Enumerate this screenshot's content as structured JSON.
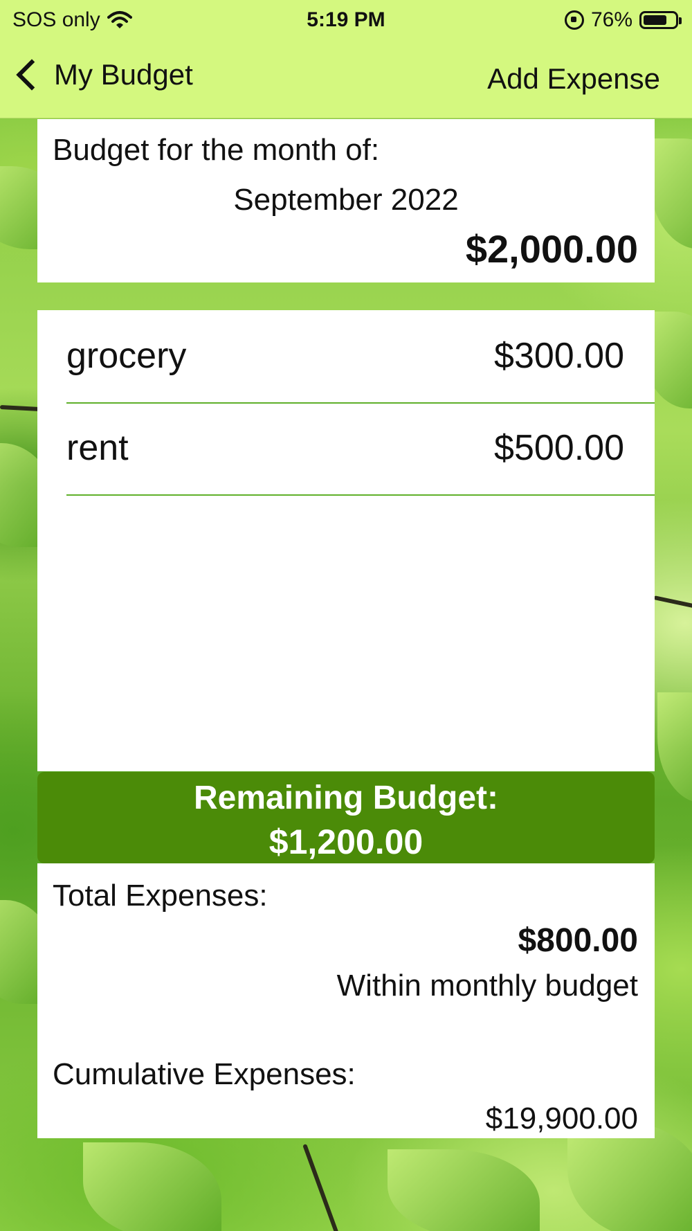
{
  "status_bar": {
    "carrier": "SOS only",
    "time": "5:19 PM",
    "battery_percent": "76%",
    "battery_level": 0.76,
    "icons": [
      "wifi-icon",
      "orientation-lock-icon",
      "battery-icon"
    ]
  },
  "nav": {
    "back_label": "My Budget",
    "action_label": "Add Expense"
  },
  "budget": {
    "label": "Budget for the month of:",
    "month": "September 2022",
    "amount": "$2,000.00"
  },
  "expenses": [
    {
      "name": "grocery",
      "amount": "$300.00"
    },
    {
      "name": "rent",
      "amount": "$500.00"
    }
  ],
  "remaining": {
    "label": "Remaining Budget:",
    "amount": "$1,200.00"
  },
  "summary": {
    "total_label": "Total Expenses:",
    "total_amount": "$800.00",
    "status": "Within monthly budget",
    "cumulative_label": "Cumulative Expenses:",
    "cumulative_amount": "$19,900.00"
  },
  "colors": {
    "nav_bar": "#d4f87f",
    "accent": "#4b8b08",
    "divider": "#5fb02a"
  }
}
